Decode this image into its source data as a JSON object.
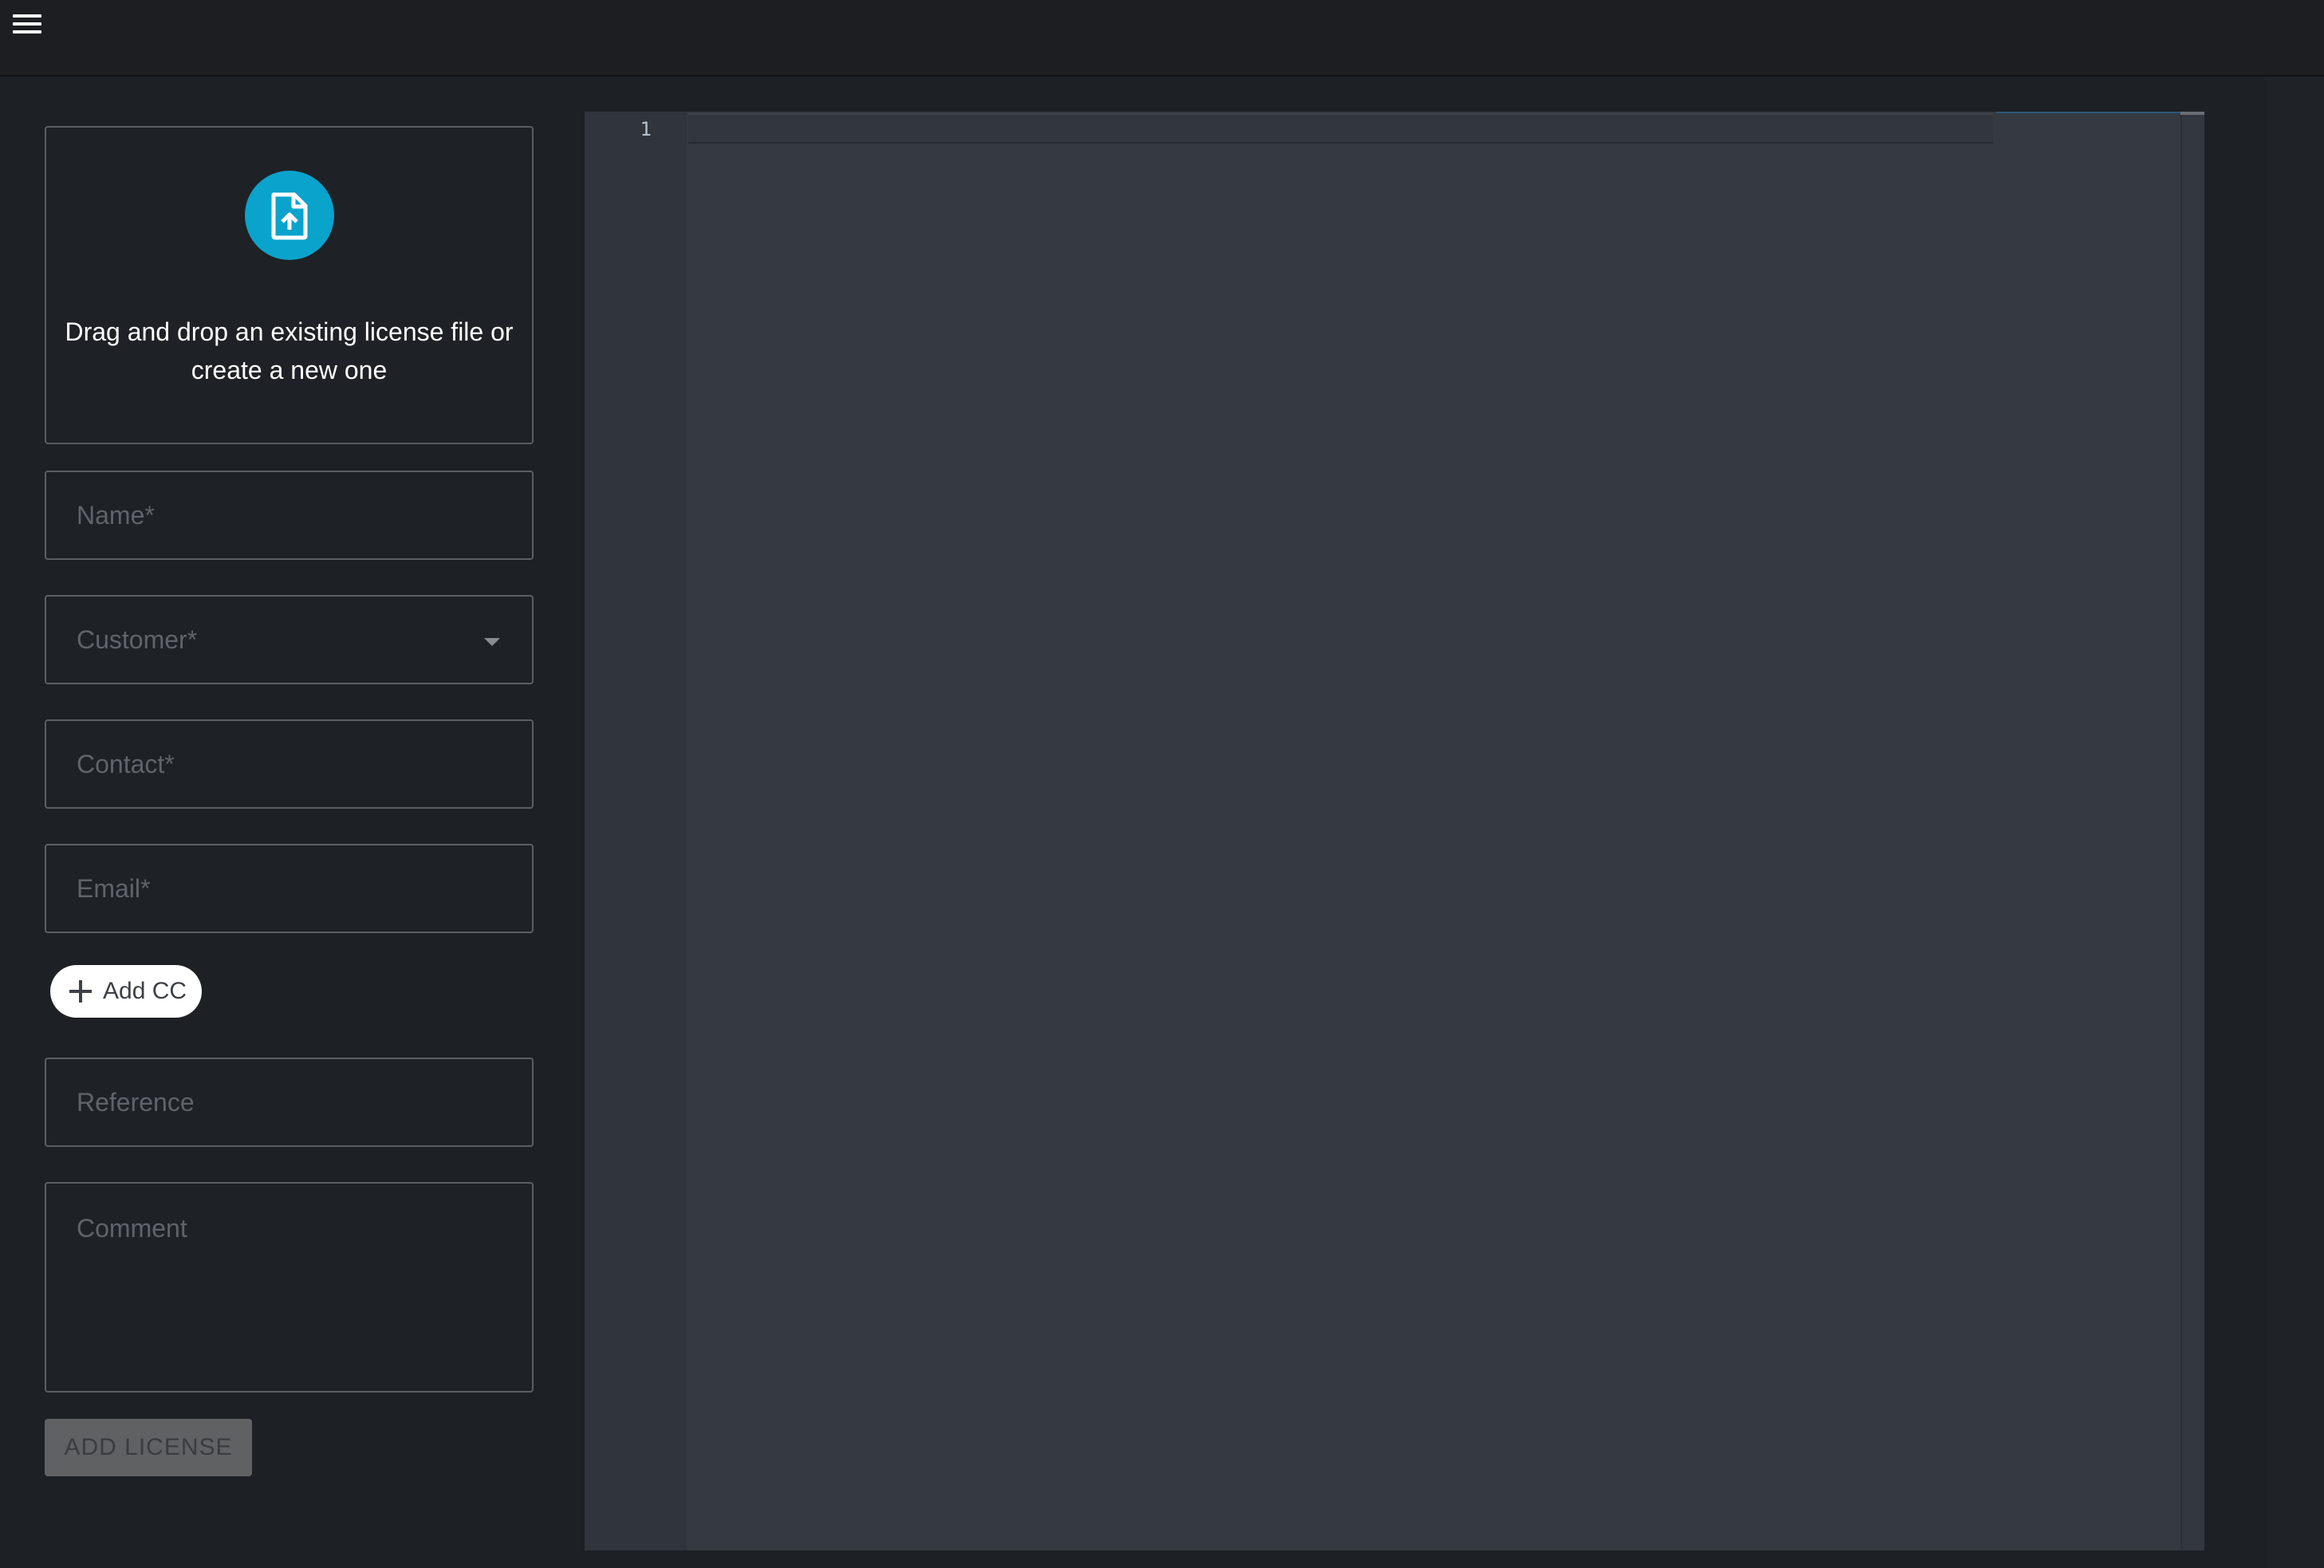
{
  "header": {
    "menu_icon": "hamburger-menu-icon"
  },
  "upload": {
    "icon": "file-upload-icon",
    "text": "Drag and drop an existing license file or create a new one",
    "accent_color": "#0aa3cc"
  },
  "form": {
    "name_placeholder": "Name*",
    "customer_placeholder": "Customer*",
    "contact_placeholder": "Contact*",
    "email_placeholder": "Email*",
    "add_cc_label": "Add CC",
    "reference_placeholder": "Reference",
    "comment_placeholder": "Comment",
    "submit_label": "ADD LICENSE"
  },
  "editor": {
    "line_numbers": [
      "1"
    ],
    "content": ""
  }
}
